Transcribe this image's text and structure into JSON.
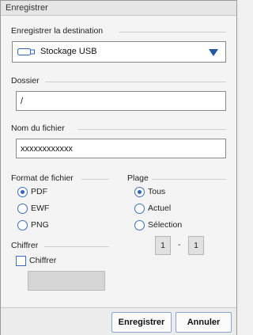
{
  "window": {
    "title": "Enregistrer"
  },
  "destination": {
    "label": "Enregistrer la destination",
    "value": "Stockage USB",
    "icon": "usb-drive-icon"
  },
  "folder": {
    "label": "Dossier",
    "value": "/"
  },
  "filename": {
    "label": "Nom du fichier",
    "value": "xxxxxxxxxxxx"
  },
  "format": {
    "label": "Format de fichier",
    "options": [
      {
        "label": "PDF",
        "checked": true
      },
      {
        "label": "EWF",
        "checked": false
      },
      {
        "label": "PNG",
        "checked": false
      }
    ]
  },
  "range": {
    "label": "Plage",
    "options": [
      {
        "label": "Tous",
        "checked": true
      },
      {
        "label": "Actuel",
        "checked": false
      },
      {
        "label": "Sélection",
        "checked": false
      }
    ],
    "from": "1",
    "separator": "-",
    "to": "1"
  },
  "encrypt": {
    "label": "Chiffrer",
    "checkbox_label": "Chiffrer",
    "checked": false
  },
  "buttons": {
    "save": "Enregistrer",
    "cancel": "Annuler"
  },
  "colors": {
    "accent": "#2d64c0",
    "caret": "#2557a7"
  }
}
